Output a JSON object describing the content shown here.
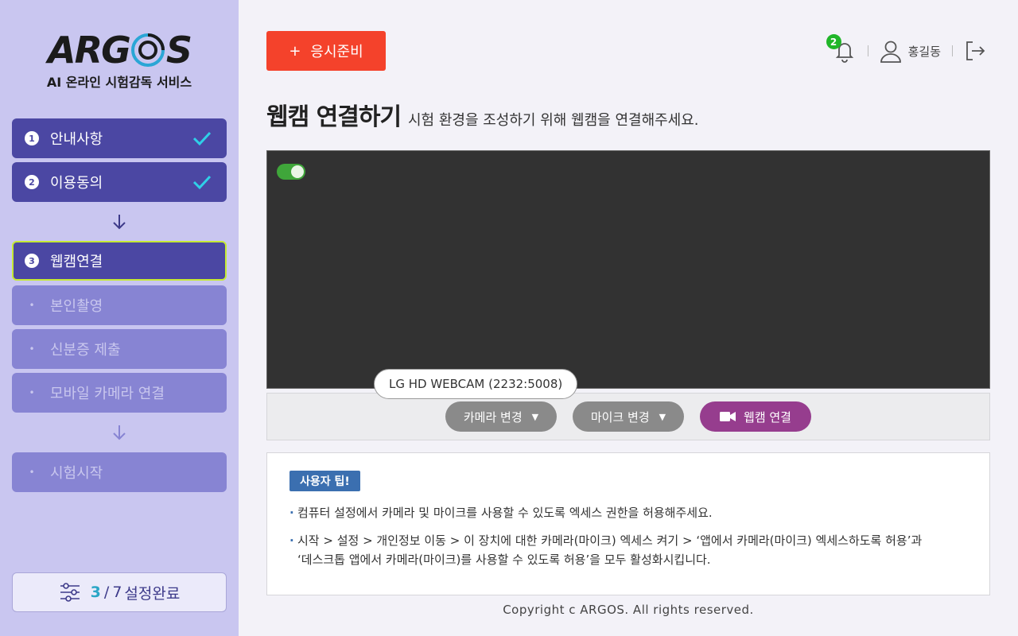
{
  "logo": {
    "word": "ARGOS",
    "subtitle": "AI 온라인 시험감독 서비스"
  },
  "steps": [
    {
      "label": "안내사항",
      "num": "1",
      "state": "done"
    },
    {
      "label": "이용동의",
      "num": "2",
      "state": "done"
    },
    {
      "label": "웹캠연결",
      "num": "3",
      "state": "active"
    },
    {
      "label": "본인촬영",
      "state": "todo"
    },
    {
      "label": "신분증 제출",
      "state": "todo"
    },
    {
      "label": "모바일 카메라 연결",
      "state": "todo"
    },
    {
      "label": "시험시작",
      "state": "todo"
    }
  ],
  "progress": {
    "current": "3",
    "total": "7",
    "label": "설정완료"
  },
  "header": {
    "prep_button": "응시준비",
    "notification_count": "2",
    "user_name": "홍길동"
  },
  "page": {
    "title": "웹캠 연결하기",
    "description": "시험 환경을 조성하기 위해 웹캠을 연결해주세요."
  },
  "webcam": {
    "toggle_on": true,
    "device_tooltip": "LG HD WEBCAM (2232:5008)",
    "camera_change": "카메라 변경",
    "mic_change": "마이크 변경",
    "connect": "웹캠 연결"
  },
  "tips": {
    "badge": "사용자 팁!",
    "line1": "컴퓨터 설정에서 카메라 및 마이크를 사용할 수 있도록 엑세스 권한을 허용해주세요.",
    "line2a": "시작 > 설정 > 개인정보 이동 > 이 장치에 대한 카메라(마이크) 엑세스 켜기 > ‘앱에서 카메라(마이크) 엑세스하도록 허용’과",
    "line2b": "‘데스크톱 앱에서 카메라(마이크)를 사용할 수 있도록 허용’을 모두 활성화시킵니다."
  },
  "footer": "Copyright c ARGOS. All rights reserved.",
  "colors": {
    "sidebar_bg": "#c9c6f0",
    "step_done": "#4b47a3",
    "step_todo": "#8784d3",
    "active_border": "#c6ea35",
    "check": "#2fd0e8",
    "prep_button": "#f4422b",
    "connect_button": "#963d8e",
    "toggle_on": "#3fa63a"
  }
}
